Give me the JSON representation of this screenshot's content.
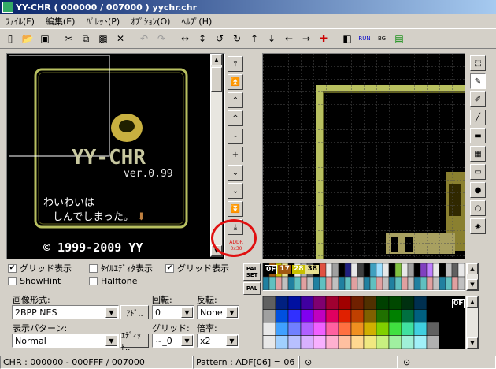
{
  "window": {
    "title": "YY-CHR ( 000000 / 007000 ) yychr.chr"
  },
  "menu": [
    "ﾌｧｲﾙ(F)",
    "編集(E)",
    "ﾊﾟﾚｯﾄ(P)",
    "ｵﾌﾟｼｮﾝ(O)",
    "ﾍﾙﾌﾟ(H)"
  ],
  "preview": {
    "banner": "YY-CHR",
    "version": "ver.0.99",
    "msg1": "わいわいは",
    "msg2": "しんでしまった。",
    "copyright": "© 1999-2009 YY"
  },
  "checks": {
    "grid": "グリッド表示",
    "showhint": "ShowHint",
    "halftone": "Halftone",
    "editor_grid": "グリッド表示"
  },
  "form": {
    "format_label": "画像形式:",
    "format_value": "2BPP NES",
    "format_btn": "ｱﾄﾞ..",
    "rotate_label": "回転:",
    "rotate_value": "0",
    "flip_label": "反転:",
    "flip_value": "None",
    "pattern_label": "表示パターン:",
    "pattern_value": "Normal",
    "pattern_btn": "ｴﾃﾞｨｯﾄ..",
    "grid_label": "グリッド:",
    "grid_value": "~_0",
    "zoom_label": "倍率:",
    "zoom_value": "x2"
  },
  "pal_buttons": {
    "set": "PAL SET",
    "pal": "PAL"
  },
  "palette_indices": [
    "0F",
    "17",
    "28",
    "38"
  ],
  "big_palette_index": "0F",
  "addr_label": [
    "ADDR",
    "0x30"
  ],
  "status": {
    "range": "CHR : 000000 - 000FFF / 007000",
    "pattern": "Pattern : ADF[06] = 06"
  },
  "colors": {
    "accent_red": "#e01010",
    "title_start": "#0a246a"
  }
}
